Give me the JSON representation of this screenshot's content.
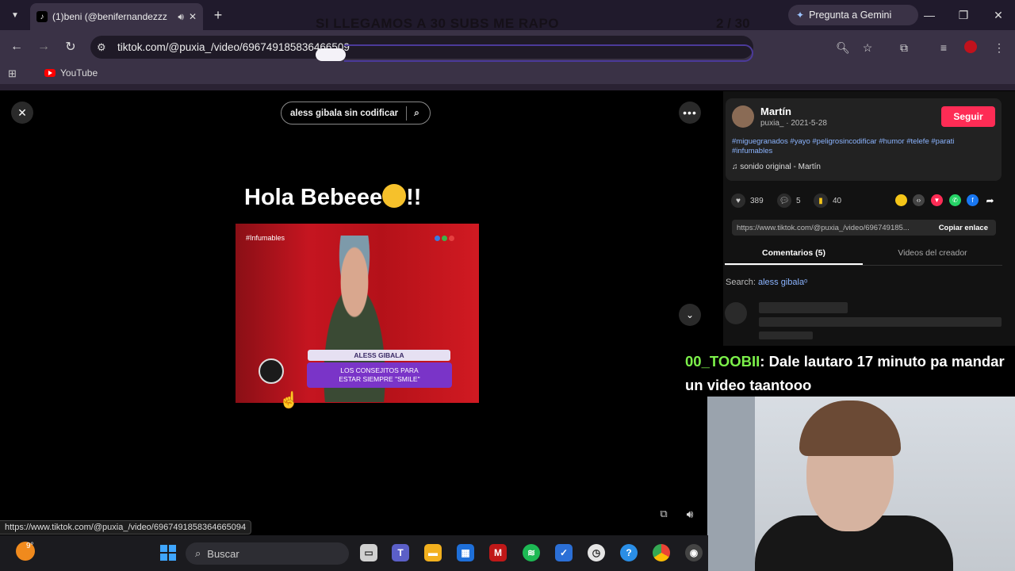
{
  "browser": {
    "tab_title": "(1)beni (@benifernandezzz",
    "gemini_label": "Pregunta a Gemini",
    "url": "tiktok.com/@puxia_/video/696749185836466509",
    "bookmarks": [
      {
        "label": "YouTube",
        "icon": "youtube-icon"
      }
    ],
    "window_controls": [
      "minimize-icon",
      "maximize-icon",
      "close-icon"
    ]
  },
  "stream_overlay": {
    "goal_text": "SI LLEGAMOS A 30 SUBS ME RAPO",
    "goal_count": "2 / 30"
  },
  "video": {
    "search_text": "aless gibala sin codificar",
    "caption": "Hola Bebeee",
    "caption_suffix": "!!",
    "show_tag": "#Infumables",
    "lower_third_name": "ALESS GIBALA",
    "lower_third_line1": "LOS CONSEJITOS PARA",
    "lower_third_line2": "ESTAR SIEMPRE \"SMILE\""
  },
  "status_bar_url": "https://www.tiktok.com/@puxia_/video/6967491858364665094",
  "post": {
    "author_name": "Martín",
    "author_meta": "puxia_ · 2021-5-28",
    "follow_label": "Seguir",
    "hashtags": "#miguegranados #yayo #peligrosincodificar #humor #telefe #parati #infumables",
    "sound": "sonido original - Martín",
    "likes": "389",
    "comments": "5",
    "saves": "40",
    "share_link": "https://www.tiktok.com/@puxia_/video/696749185...",
    "copy_label": "Copiar enlace",
    "tab_comments": "Comentarios (5)",
    "tab_videos": "Videos del creador",
    "search_prefix": "Search: ",
    "search_query": "aless gibala"
  },
  "chat": {
    "username": "00_TOOBII",
    "message": ": Dale lautaro 17 minuto pa mandar un video taantooo"
  },
  "taskbar": {
    "temperature": "9°",
    "search_placeholder": "Buscar",
    "apps": [
      "file-explorer-icon",
      "teams-icon",
      "folder-icon",
      "store-icon",
      "mcafee-icon",
      "spotify-icon",
      "todo-icon",
      "clock-icon",
      "help-icon",
      "chrome-icon"
    ]
  },
  "colors": {
    "tiktok_red": "#fe2c55",
    "chat_user": "#7cf04a",
    "hashtag_blue": "#8bb4ff",
    "chrome_bg": "#3a3246"
  }
}
